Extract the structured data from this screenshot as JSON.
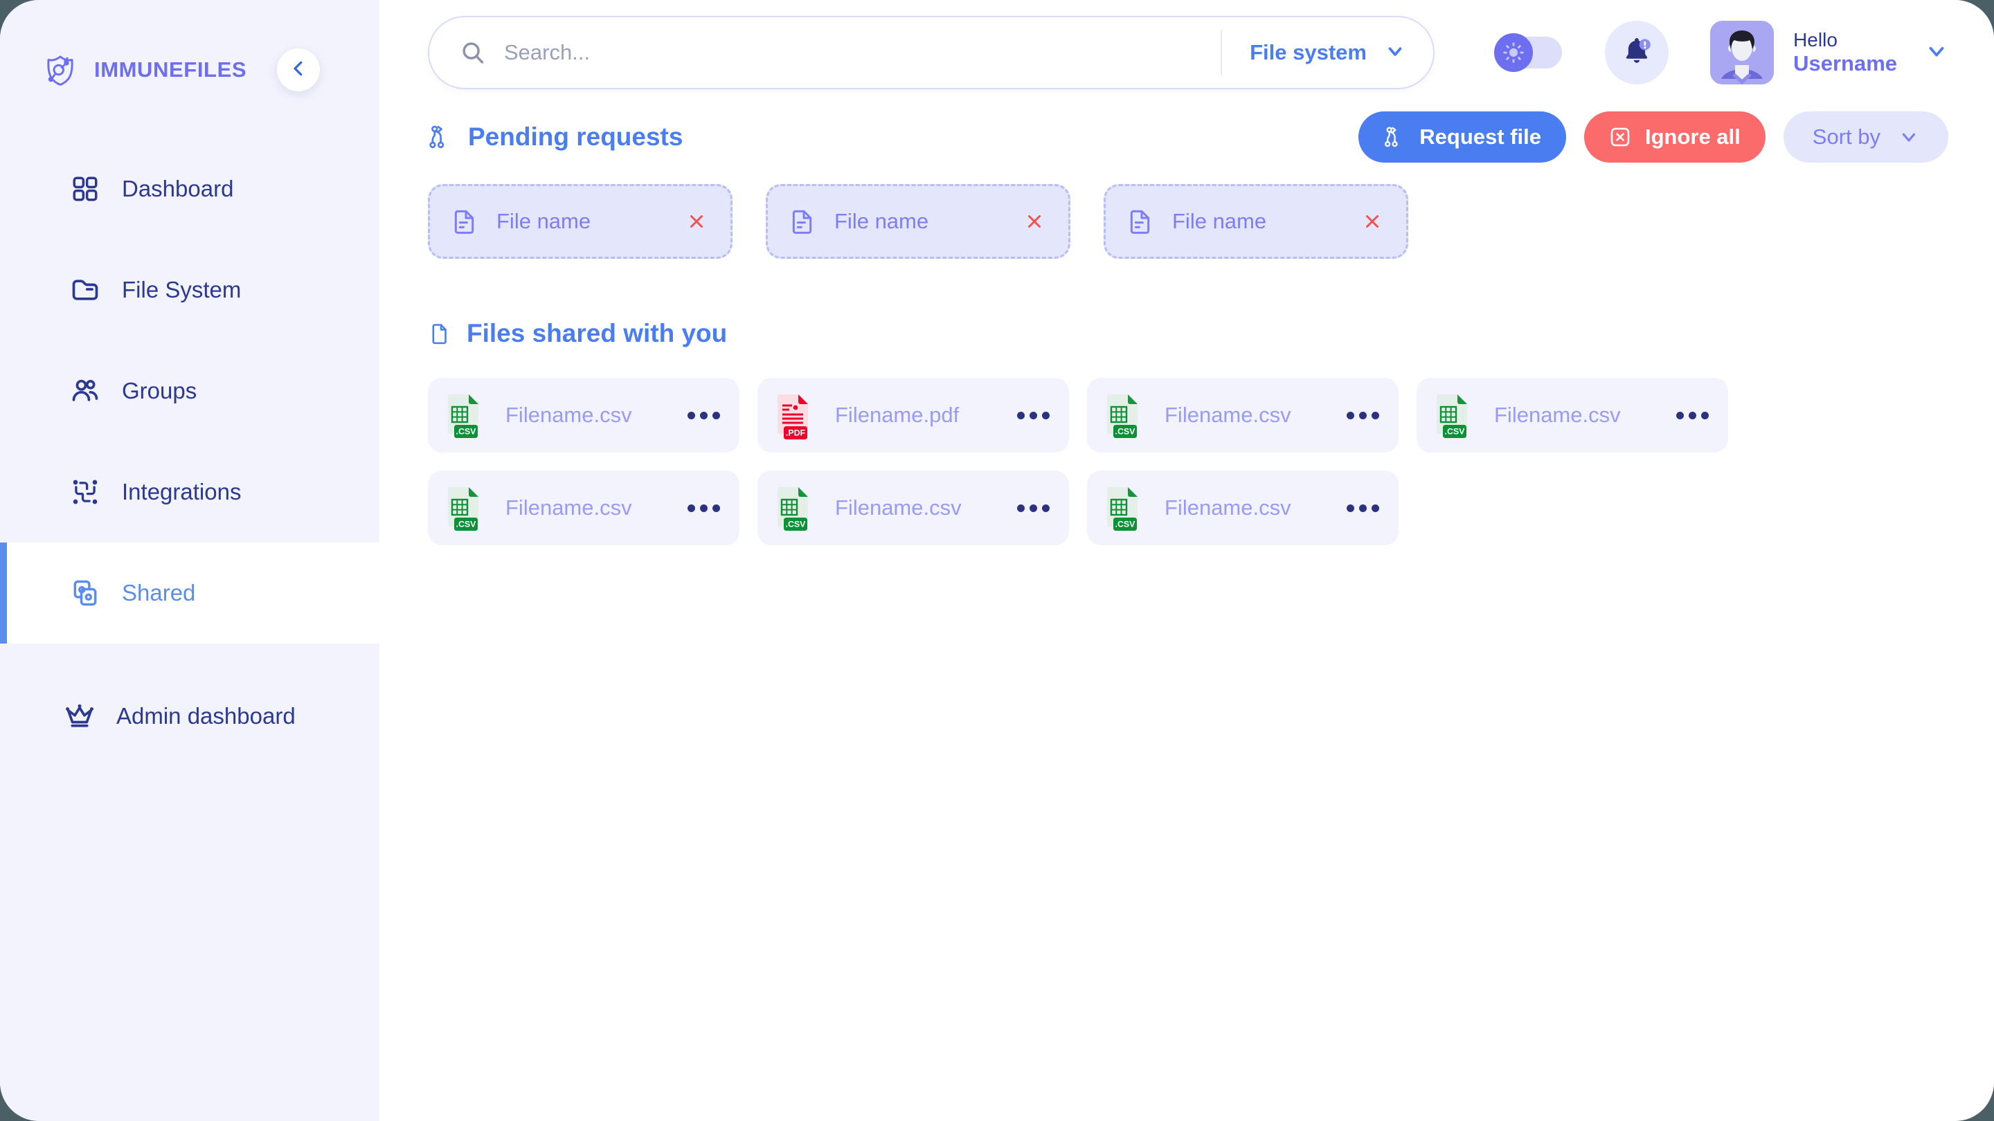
{
  "brand": {
    "name": "IMMUNEFILES",
    "logo_icon": "shield-virus-icon",
    "collapse_icon": "chevron-left-icon"
  },
  "sidebar": {
    "items": [
      {
        "label": "Dashboard",
        "icon": "grid-icon",
        "active": false
      },
      {
        "label": "File System",
        "icon": "folder-icon",
        "active": false
      },
      {
        "label": "Groups",
        "icon": "users-icon",
        "active": false
      },
      {
        "label": "Integrations",
        "icon": "integrations-icon",
        "active": false
      },
      {
        "label": "Shared",
        "icon": "shared-nodes-icon",
        "active": true
      }
    ],
    "admin": {
      "label": "Admin dashboard",
      "icon": "crown-icon"
    }
  },
  "header": {
    "search": {
      "placeholder": "Search...",
      "value": "",
      "icon": "search-icon"
    },
    "scope": {
      "label": "File system",
      "chevron_icon": "chevron-down-icon"
    },
    "theme_toggle": {
      "state": "light",
      "icon": "sun-icon"
    },
    "notifications": {
      "icon": "bell-icon",
      "badge": "!"
    },
    "user": {
      "greeting": "Hello",
      "name": "Username",
      "avatar_icon": "user-avatar",
      "chevron_icon": "chevron-down-icon"
    }
  },
  "pending": {
    "title": "Pending requests",
    "title_icon": "share-nodes-icon",
    "actions": {
      "request_file": {
        "label": "Request file",
        "icon": "share-nodes-icon"
      },
      "ignore_all": {
        "label": "Ignore all",
        "icon": "x-box-icon"
      },
      "sort_by": {
        "label": "Sort by",
        "chevron_icon": "chevron-down-icon"
      }
    },
    "cards": [
      {
        "name": "File name",
        "icon": "document-icon",
        "close_icon": "close-icon"
      },
      {
        "name": "File name",
        "icon": "document-icon",
        "close_icon": "close-icon"
      },
      {
        "name": "File name",
        "icon": "document-icon",
        "close_icon": "close-icon"
      }
    ]
  },
  "shared": {
    "title": "Files shared with you",
    "title_icon": "file-icon",
    "files": [
      {
        "name": "Filename.csv",
        "type": "csv",
        "badge": ".CSV",
        "more_icon": "more-horizontal-icon"
      },
      {
        "name": "Filename.pdf",
        "type": "pdf",
        "badge": ".PDF",
        "more_icon": "more-horizontal-icon"
      },
      {
        "name": "Filename.csv",
        "type": "csv",
        "badge": ".CSV",
        "more_icon": "more-horizontal-icon"
      },
      {
        "name": "Filename.csv",
        "type": "csv",
        "badge": ".CSV",
        "more_icon": "more-horizontal-icon"
      },
      {
        "name": "Filename.csv",
        "type": "csv",
        "badge": ".CSV",
        "more_icon": "more-horizontal-icon"
      },
      {
        "name": "Filename.csv",
        "type": "csv",
        "badge": ".CSV",
        "more_icon": "more-horizontal-icon"
      },
      {
        "name": "Filename.csv",
        "type": "csv",
        "badge": ".CSV",
        "more_icon": "more-horizontal-icon"
      }
    ]
  },
  "colors": {
    "page_background": "#4a6066",
    "app_background": "#ffffff",
    "sidebar_background": "#f2f3fd",
    "brand_purple": "#6d6ef0",
    "nav_navy": "#2b3990",
    "accent_blue": "#4a7df0",
    "active_blue": "#5b8def",
    "danger_red": "#fb6b6b",
    "soft_violet": "#e4e6fb",
    "file_card_bg": "#f2f3fd",
    "file_name_violet": "#9a9bf3",
    "csv_green": "#0d9136",
    "pdf_red": "#e8062a"
  }
}
